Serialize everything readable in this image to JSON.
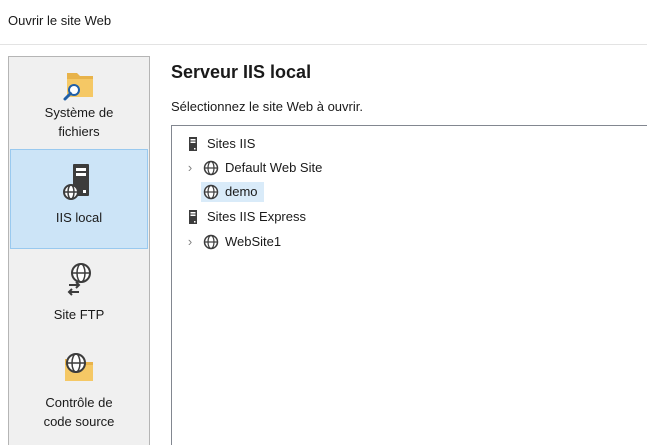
{
  "window": {
    "title": "Ouvrir le site Web"
  },
  "sidebar": {
    "items": [
      {
        "label_line1": "Système de",
        "label_line2": "fichiers",
        "icon": "folder-search-icon",
        "selected": false
      },
      {
        "label": "IIS local",
        "icon": "server-globe-icon",
        "selected": true
      },
      {
        "label": "Site FTP",
        "icon": "ftp-globe-icon",
        "selected": false
      },
      {
        "label_line1": "Contrôle de",
        "label_line2": "code source",
        "icon": "folder-globe-icon",
        "selected": false
      }
    ]
  },
  "main": {
    "title": "Serveur IIS local",
    "subtitle": "Sélectionnez le site Web à ouvrir."
  },
  "tree": {
    "nodes": [
      {
        "label": "Sites IIS",
        "icon": "server-icon",
        "expandable": false,
        "selected": false
      },
      {
        "label": "Default Web Site",
        "icon": "globe-icon",
        "expandable": true,
        "selected": false
      },
      {
        "label": "demo",
        "icon": "globe-icon",
        "expandable": false,
        "selected": true
      },
      {
        "label": "Sites IIS Express",
        "icon": "server-icon",
        "expandable": false,
        "selected": false
      },
      {
        "label": "WebSite1",
        "icon": "globe-icon",
        "expandable": true,
        "selected": false
      }
    ]
  },
  "colors": {
    "selection_sidebar": "#cce4f7",
    "selection_tree": "#d9ebf9",
    "folder": "#e8b34a",
    "server": "#3c3c3c"
  }
}
